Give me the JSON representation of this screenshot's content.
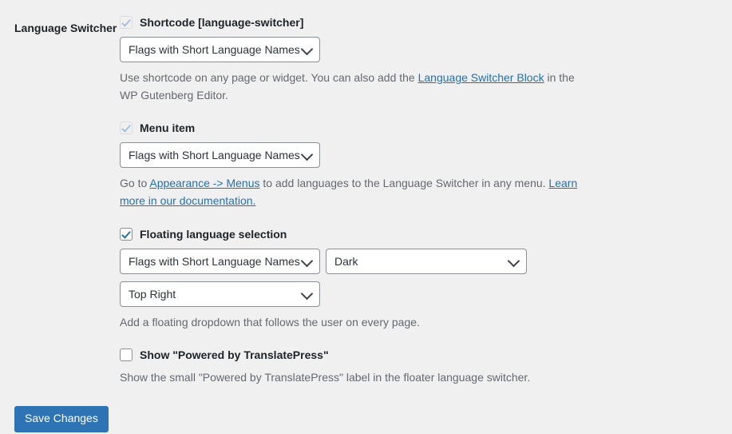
{
  "section": {
    "label": "Language Switcher"
  },
  "shortcode": {
    "checkbox_state": "checked-disabled",
    "label": "Shortcode [language-switcher]",
    "select_value": "Flags with Short Language Names",
    "desc_part1": "Use shortcode on any page or widget. You can also add the ",
    "desc_link": "Language Switcher Block",
    "desc_part2": " in the WP Gutenberg Editor."
  },
  "menu_item": {
    "checkbox_state": "checked-disabled",
    "label": "Menu item",
    "select_value": "Flags with Short Language Names",
    "desc_part1": "Go to ",
    "desc_link1": "Appearance -> Menus",
    "desc_part2": " to add languages to the Language Switcher in any menu. ",
    "desc_link2": "Learn more in our documentation."
  },
  "floating": {
    "checkbox_state": "checked-active",
    "label": "Floating language selection",
    "select_value": "Flags with Short Language Names",
    "theme_value": "Dark",
    "position_value": "Top Right",
    "desc": "Add a floating dropdown that follows the user on every page."
  },
  "powered_by": {
    "checkbox_state": "unchecked",
    "label": "Show \"Powered by TranslatePress\"",
    "desc": "Show the small \"Powered by TranslatePress\" label in the floater language switcher."
  },
  "submit": {
    "save_label": "Save Changes"
  },
  "colors": {
    "accent": "#2271b1",
    "button": "#2e73b4",
    "background": "#f0f0f1",
    "text": "#3c434a",
    "muted_text": "#646970"
  }
}
